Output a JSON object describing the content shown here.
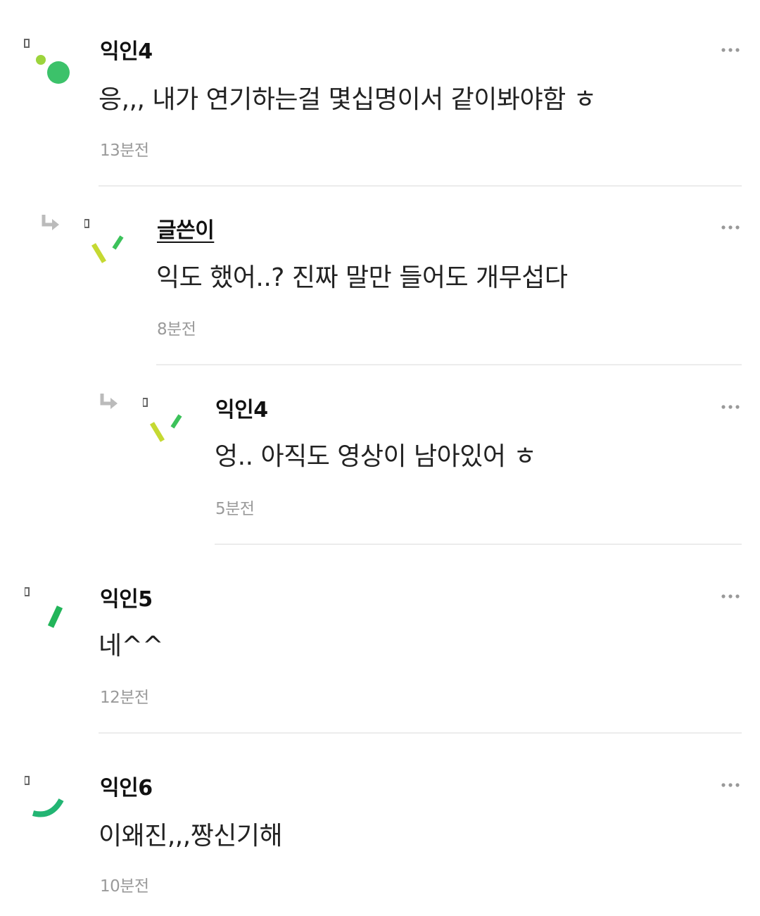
{
  "comments": [
    {
      "nickname": "익인4",
      "text": "응,,, 내가 연기하는걸 몇십명이서 같이봐야함 ㅎ",
      "time": "13분전",
      "is_author": false,
      "is_reply": false,
      "avatar_icon": "dots-avatar-icon",
      "avatar_color": "#3cc26a"
    },
    {
      "nickname": "글쓴이",
      "text": "익도 했어..? 진짜 말만 들어도 개무섭다",
      "time": "8분전",
      "is_author": true,
      "is_reply": true,
      "avatar_icon": "dashes-avatar-icon",
      "avatar_color": "#c5d932"
    },
    {
      "nickname": "익인4",
      "text": "엉.. 아직도 영상이 남아있어 ㅎ",
      "time": "5분전",
      "is_author": false,
      "is_reply": true,
      "avatar_icon": "dashes-avatar-icon",
      "avatar_color": "#c5d932"
    },
    {
      "nickname": "익인5",
      "text": "네^^",
      "time": "12분전",
      "is_author": false,
      "is_reply": false,
      "avatar_icon": "slash-avatar-icon",
      "avatar_color": "#22b55a"
    },
    {
      "nickname": "익인6",
      "text": "이왜진,,,짱신기해",
      "time": "10분전",
      "is_author": false,
      "is_reply": false,
      "avatar_icon": "arc-avatar-icon",
      "avatar_color": "#22b573"
    }
  ],
  "icons": {
    "more": "more-options-icon",
    "reply": "reply-arrow-icon"
  },
  "colors": {
    "nickname": "#111111",
    "time": "#9a9a9a",
    "divider": "#ececec",
    "icon_gray": "#bbbbbb"
  }
}
